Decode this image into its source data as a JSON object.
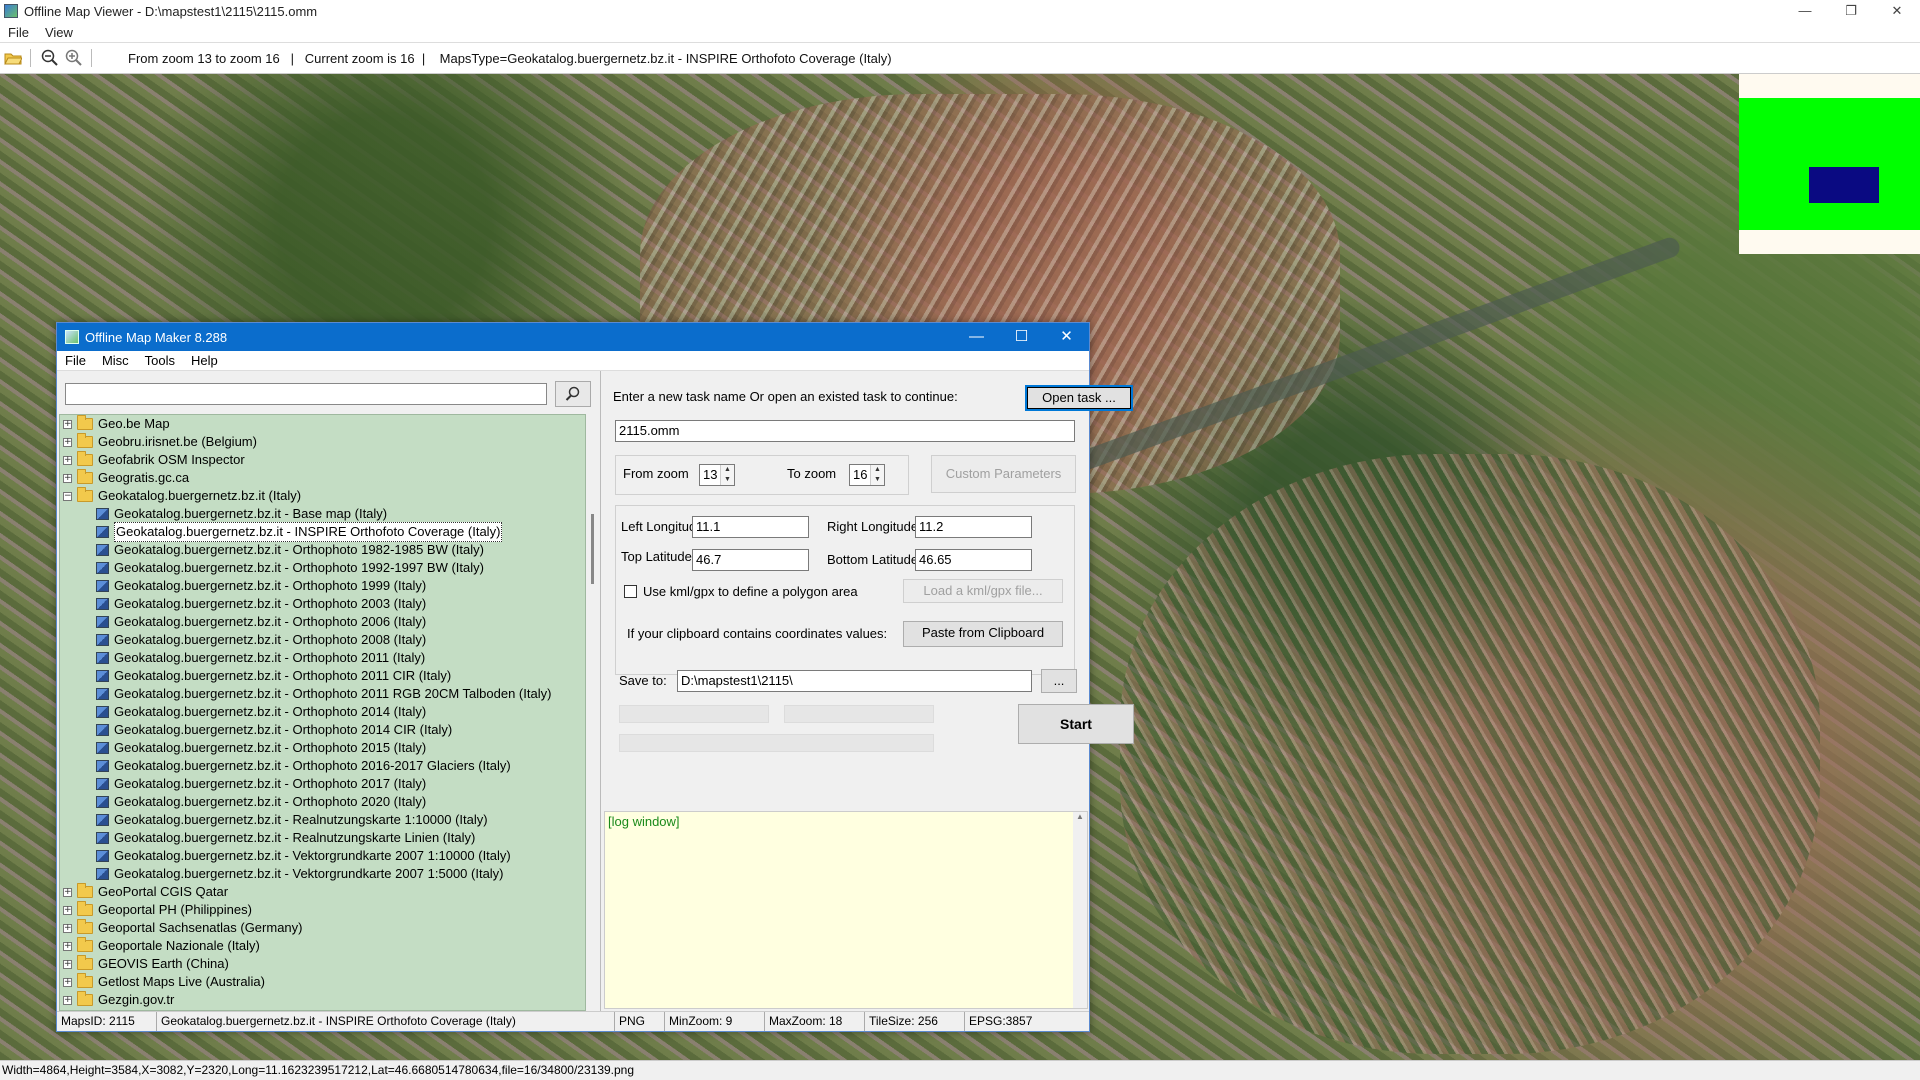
{
  "viewer": {
    "title": "Offline Map Viewer - D:\\mapstest1\\2115\\2115.omm",
    "menu": [
      "File",
      "View"
    ],
    "toolbar_text": "From zoom 13 to zoom 16   |   Current zoom is 16  |    MapsType=Geokatalog.buergernetz.bz.it - INSPIRE Orthofoto Coverage (Italy)",
    "status": "Width=4864,Height=3584,X=3082,Y=2320,Long=11.1623239517212,Lat=46.6680514780634,file=16/34800/23139.png",
    "window_controls": [
      "—",
      "❐",
      "✕"
    ]
  },
  "omm": {
    "title": "Offline Map Maker 8.288",
    "menu": [
      "File",
      "Misc",
      "Tools",
      "Help"
    ],
    "window_controls": [
      "—",
      "☐",
      "✕"
    ],
    "search": {
      "value": "",
      "placeholder": ""
    },
    "tree": [
      {
        "type": "folder",
        "label": "Geo.be Map",
        "expanded": false
      },
      {
        "type": "folder",
        "label": "Geobru.irisnet.be (Belgium)",
        "expanded": false
      },
      {
        "type": "folder",
        "label": "Geofabrik OSM Inspector",
        "expanded": false
      },
      {
        "type": "folder",
        "label": "Geogratis.gc.ca",
        "expanded": false
      },
      {
        "type": "folder",
        "label": "Geokatalog.buergernetz.bz.it (Italy)",
        "expanded": true
      },
      {
        "type": "map",
        "label": "Geokatalog.buergernetz.bz.it - Base map (Italy)"
      },
      {
        "type": "map",
        "label": "Geokatalog.buergernetz.bz.it - INSPIRE Orthofoto Coverage (Italy)",
        "selected": true
      },
      {
        "type": "map",
        "label": "Geokatalog.buergernetz.bz.it - Orthophoto 1982-1985 BW (Italy)"
      },
      {
        "type": "map",
        "label": "Geokatalog.buergernetz.bz.it - Orthophoto 1992-1997 BW (Italy)"
      },
      {
        "type": "map",
        "label": "Geokatalog.buergernetz.bz.it - Orthophoto 1999 (Italy)"
      },
      {
        "type": "map",
        "label": "Geokatalog.buergernetz.bz.it - Orthophoto 2003 (Italy)"
      },
      {
        "type": "map",
        "label": "Geokatalog.buergernetz.bz.it - Orthophoto 2006 (Italy)"
      },
      {
        "type": "map",
        "label": "Geokatalog.buergernetz.bz.it - Orthophoto 2008 (Italy)"
      },
      {
        "type": "map",
        "label": "Geokatalog.buergernetz.bz.it - Orthophoto 2011 (Italy)"
      },
      {
        "type": "map",
        "label": "Geokatalog.buergernetz.bz.it - Orthophoto 2011 CIR (Italy)"
      },
      {
        "type": "map",
        "label": "Geokatalog.buergernetz.bz.it - Orthophoto 2011 RGB 20CM Talboden (Italy)"
      },
      {
        "type": "map",
        "label": "Geokatalog.buergernetz.bz.it - Orthophoto 2014 (Italy)"
      },
      {
        "type": "map",
        "label": "Geokatalog.buergernetz.bz.it - Orthophoto 2014 CIR (Italy)"
      },
      {
        "type": "map",
        "label": "Geokatalog.buergernetz.bz.it - Orthophoto 2015 (Italy)"
      },
      {
        "type": "map",
        "label": "Geokatalog.buergernetz.bz.it - Orthophoto 2016-2017 Glaciers (Italy)"
      },
      {
        "type": "map",
        "label": "Geokatalog.buergernetz.bz.it - Orthophoto 2017 (Italy)"
      },
      {
        "type": "map",
        "label": "Geokatalog.buergernetz.bz.it - Orthophoto 2020 (Italy)"
      },
      {
        "type": "map",
        "label": "Geokatalog.buergernetz.bz.it - Realnutzungskarte 1:10000 (Italy)"
      },
      {
        "type": "map",
        "label": "Geokatalog.buergernetz.bz.it - Realnutzungskarte Linien (Italy)"
      },
      {
        "type": "map",
        "label": "Geokatalog.buergernetz.bz.it - Vektorgrundkarte 2007 1:10000 (Italy)"
      },
      {
        "type": "map",
        "label": "Geokatalog.buergernetz.bz.it - Vektorgrundkarte 2007 1:5000 (Italy)"
      },
      {
        "type": "folder",
        "label": "GeoPortal CGIS Qatar",
        "expanded": false
      },
      {
        "type": "folder",
        "label": "Geoportal PH (Philippines)",
        "expanded": false
      },
      {
        "type": "folder",
        "label": "Geoportal Sachsenatlas (Germany)",
        "expanded": false
      },
      {
        "type": "folder",
        "label": "Geoportale Nazionale (Italy)",
        "expanded": false
      },
      {
        "type": "folder",
        "label": "GEOVIS Earth (China)",
        "expanded": false
      },
      {
        "type": "folder",
        "label": "Getlost Maps Live (Australia)",
        "expanded": false
      },
      {
        "type": "folder",
        "label": "Gezgin.gov.tr",
        "expanded": false
      }
    ],
    "task_prompt": "Enter a new task name Or open an existed task to continue:",
    "open_task_label": "Open task ...",
    "task_name": "2115.omm",
    "from_zoom_label": "From zoom",
    "from_zoom": "13",
    "to_zoom_label": "To zoom",
    "to_zoom": "16",
    "custom_params_label": "Custom Parameters",
    "left_lon_label": "Left Longitude",
    "left_lon": "11.1",
    "right_lon_label": "Right Longitude",
    "right_lon": "11.2",
    "top_lat_label": "Top Latitude",
    "top_lat": "46.7",
    "bottom_lat_label": "Bottom Latitude",
    "bottom_lat": "46.65",
    "kml_label": "Use kml/gpx to define a polygon area",
    "load_kml_label": "Load a kml/gpx file...",
    "clipboard_label": "If your clipboard contains coordinates values:",
    "paste_label": "Paste from Clipboard",
    "save_to_label": "Save to:",
    "save_to": "D:\\mapstest1\\2115\\",
    "browse_label": "...",
    "start_label": "Start",
    "log_text": "[log window]",
    "status": {
      "maps_id": "MapsID: 2115",
      "map_name": "Geokatalog.buergernetz.bz.it - INSPIRE Orthofoto Coverage (Italy)",
      "format": "PNG",
      "min_zoom": "MinZoom: 9",
      "max_zoom": "MaxZoom: 18",
      "tile_size": "TileSize: 256",
      "epsg": "EPSG:3857"
    }
  },
  "colors": {
    "accent": "#0b6dcc",
    "tree_bg": "#c4ddc4",
    "log_bg": "#ffffe0",
    "overview_green": "#00ff00",
    "overview_viewport": "#0a0a82"
  }
}
